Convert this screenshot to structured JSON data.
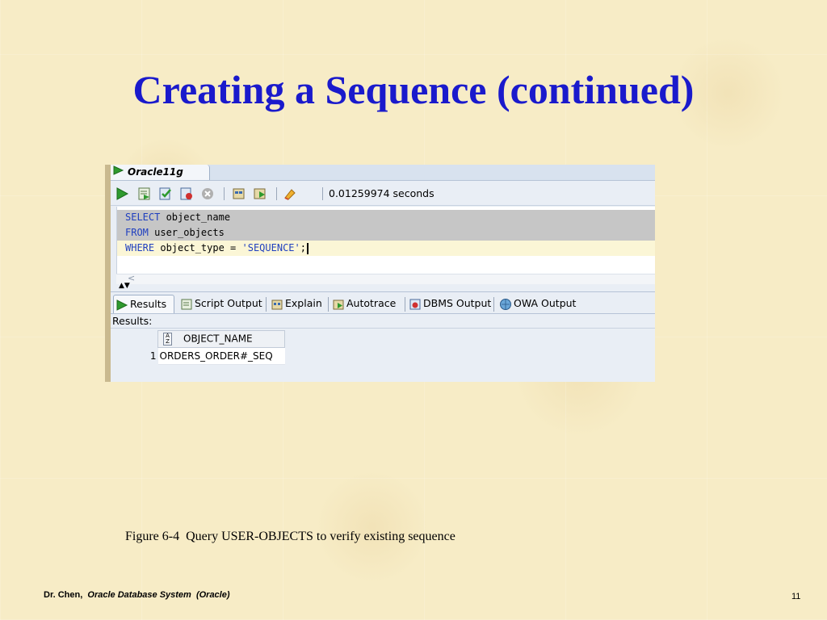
{
  "slide": {
    "title": "Creating a Sequence (continued)",
    "caption": "Figure 6-4  Query USER-OBJECTS to verify existing sequence",
    "footer_author": "Dr. Chen,",
    "footer_course": "Oracle Database System  (Oracle)",
    "page_number": "11",
    "title_color": "#1a1acc"
  },
  "screenshot": {
    "connection_tab": "Oracle11g",
    "toolbar": {
      "elapsed": "0.01259974 seconds",
      "icons": [
        "run-statement-icon",
        "run-script-icon",
        "commit-icon",
        "rollback-icon",
        "cancel-icon",
        "sql-tuning-icon",
        "explain-plan-icon",
        "clear-icon"
      ]
    },
    "editor": {
      "line1_kw": "SELECT",
      "line1_rest": " object_name",
      "line2_kw": "FROM",
      "line2_rest": " user_objects",
      "line3_kw": "WHERE",
      "line3_mid": " object_type = ",
      "line3_str": "'SEQUENCE'",
      "line3_end": ";"
    },
    "result_tabs": [
      "Results",
      "Script Output",
      "Explain",
      "Autotrace",
      "DBMS Output",
      "OWA Output"
    ],
    "results_label": "Results:",
    "grid": {
      "column": "OBJECT_NAME",
      "rows": [
        {
          "num": "1",
          "value": "ORDERS_ORDER#_SEQ"
        }
      ]
    }
  }
}
